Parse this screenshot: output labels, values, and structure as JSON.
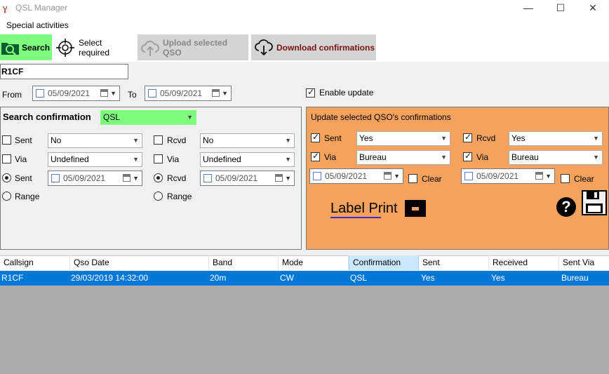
{
  "window": {
    "title": "QSL Manager",
    "minimize": "—",
    "maximize": "☐",
    "close": "✕"
  },
  "menu": {
    "special_activities": "Special activities"
  },
  "toolbar": {
    "search": "Search",
    "select_required": "Select required",
    "upload_selected": "Upload selected QSO",
    "download_confirmations": "Download confirmations"
  },
  "callsign_value": "R1CF",
  "filter": {
    "from_label": "From",
    "from_date": "05/09/2021",
    "to_label": "To",
    "to_date": "05/09/2021",
    "enable_update_label": "Enable update"
  },
  "search_panel": {
    "title": "Search confirmation",
    "confirmation_value": "QSL",
    "sent_label": "Sent",
    "sent_value": "No",
    "rcvd_label": "Rcvd",
    "rcvd_value": "No",
    "via_label": "Via",
    "via_sent_value": "Undefined",
    "via_rcvd_value": "Undefined",
    "sent_date_label": "Sent",
    "sent_date": "05/09/2021",
    "rcvd_date_label": "Rcvd",
    "rcvd_date": "05/09/2021",
    "range_label": "Range"
  },
  "update_panel": {
    "title": "Update selected QSO's confirmations",
    "sent_label": "Sent",
    "sent_value": "Yes",
    "rcvd_label": "Rcvd",
    "rcvd_value": "Yes",
    "via_label": "Via",
    "via_sent_value": "Bureau",
    "via_rcvd_value": "Bureau",
    "sent_date": "05/09/2021",
    "rcvd_date": "05/09/2021",
    "clear_label": "Clear",
    "label_print": "Label Print",
    "help_glyph": "?"
  },
  "grid": {
    "columns": [
      "Callsign",
      "Qso Date",
      "Band",
      "Mode",
      "Confirmation",
      "Sent",
      "Received",
      "Sent Via"
    ],
    "rows": [
      [
        "R1CF",
        "29/03/2019 14:32:00",
        "20m",
        "CW",
        "QSL",
        "Yes",
        "Yes",
        "Bureau"
      ]
    ]
  },
  "colors": {
    "search_button": "#7dfc7d",
    "update_panel": "#f4a25e",
    "selected_row": "#0078d7",
    "confirmation_combo": "#7dfc7d"
  }
}
